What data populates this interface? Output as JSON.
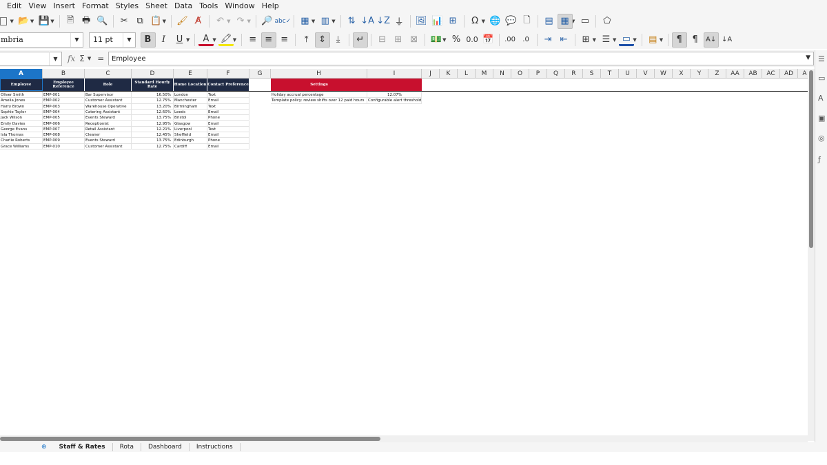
{
  "menu": [
    "Edit",
    "View",
    "Insert",
    "Format",
    "Styles",
    "Sheet",
    "Data",
    "Tools",
    "Window",
    "Help"
  ],
  "font": {
    "name": "mbria",
    "size": "11 pt"
  },
  "formula": {
    "content": "Employee"
  },
  "columns": [
    {
      "label": "A",
      "w": 62,
      "sel": true
    },
    {
      "label": "B",
      "w": 61
    },
    {
      "label": "C",
      "w": 68
    },
    {
      "label": "D",
      "w": 61
    },
    {
      "label": "E",
      "w": 49
    },
    {
      "label": "F",
      "w": 61
    },
    {
      "label": "G",
      "w": 31
    },
    {
      "label": "H",
      "w": 140
    },
    {
      "label": "I",
      "w": 79
    },
    {
      "label": "J",
      "w": 26
    },
    {
      "label": "K",
      "w": 26
    },
    {
      "label": "L",
      "w": 26
    },
    {
      "label": "M",
      "w": 26
    },
    {
      "label": "N",
      "w": 26
    },
    {
      "label": "O",
      "w": 26
    },
    {
      "label": "P",
      "w": 26
    },
    {
      "label": "Q",
      "w": 26
    },
    {
      "label": "R",
      "w": 26
    },
    {
      "label": "S",
      "w": 26
    },
    {
      "label": "T",
      "w": 26
    },
    {
      "label": "U",
      "w": 26
    },
    {
      "label": "V",
      "w": 26
    },
    {
      "label": "W",
      "w": 26
    },
    {
      "label": "X",
      "w": 26
    },
    {
      "label": "Y",
      "w": 26
    },
    {
      "label": "Z",
      "w": 26
    },
    {
      "label": "AA",
      "w": 26
    },
    {
      "label": "AB",
      "w": 26
    },
    {
      "label": "AC",
      "w": 26
    },
    {
      "label": "AD",
      "w": 26
    },
    {
      "label": "A",
      "w": 20
    }
  ],
  "table": {
    "headers": [
      "Employee",
      "Employee Reference",
      "Role",
      "Standard Hourly Rate",
      "Home Location",
      "Contact Preference"
    ],
    "rows": [
      [
        "Oliver Smith",
        "EMP-001",
        "Bar Supervisor",
        "16.50%",
        "London",
        "Text"
      ],
      [
        "Amelia Jones",
        "EMP-002",
        "Customer Assistant",
        "12.75%",
        "Manchester",
        "Email"
      ],
      [
        "Harry Brown",
        "EMP-003",
        "Warehouse Operative",
        "13.20%",
        "Birmingham",
        "Text"
      ],
      [
        "Sophie Taylor",
        "EMP-004",
        "Catering Assistant",
        "12.60%",
        "Leeds",
        "Email"
      ],
      [
        "Jack Wilson",
        "EMP-005",
        "Events Steward",
        "13.75%",
        "Bristol",
        "Phone"
      ],
      [
        "Emily Davies",
        "EMP-006",
        "Receptionist",
        "12.95%",
        "Glasgow",
        "Email"
      ],
      [
        "George Evans",
        "EMP-007",
        "Retail Assistant",
        "12.21%",
        "Liverpool",
        "Text"
      ],
      [
        "Isla Thomas",
        "EMP-008",
        "Cleaner",
        "12.45%",
        "Sheffield",
        "Email"
      ],
      [
        "Charlie Roberts",
        "EMP-009",
        "Events Steward",
        "13.75%",
        "Edinburgh",
        "Phone"
      ],
      [
        "Grace Williams",
        "EMP-010",
        "Customer Assistant",
        "12.75%",
        "Cardiff",
        "Email"
      ]
    ]
  },
  "settings": {
    "header": "Settings",
    "rows": [
      [
        "Holiday accrual percentage",
        "12.07%"
      ],
      [
        "Template policy: review shifts over 12 paid hours",
        "Configurable alert threshold"
      ]
    ]
  },
  "tabs": {
    "nav_label": "",
    "items": [
      {
        "label": "Staff & Rates",
        "active": true
      },
      {
        "label": "Rota"
      },
      {
        "label": "Dashboard"
      },
      {
        "label": "Instructions"
      }
    ]
  },
  "colors": {
    "table_header": "#1f2a44",
    "settings_header": "#c8102e",
    "selection": "#1c75c8"
  }
}
